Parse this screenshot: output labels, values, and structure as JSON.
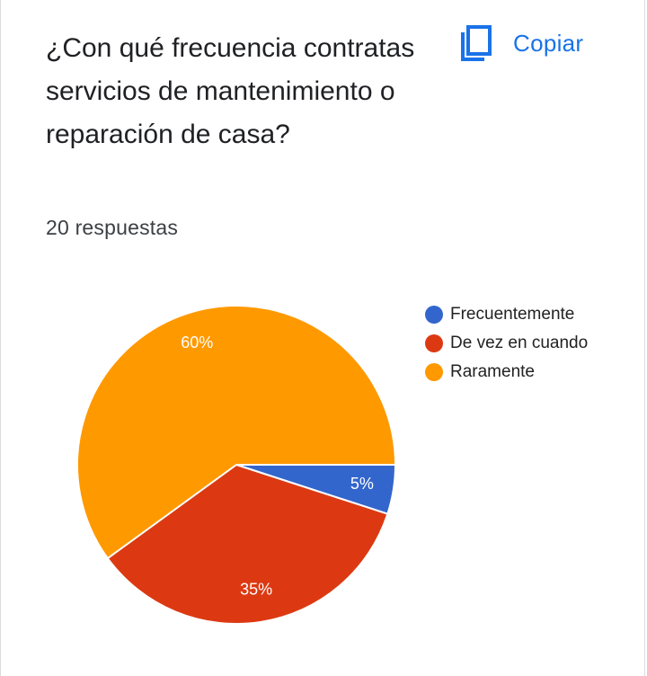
{
  "question": {
    "title": "¿Con qué frecuencia contratas servicios de mantenimiento o reparación de casa?",
    "response_count": "20 respuestas"
  },
  "copy_button": {
    "label": "Copiar",
    "icon": "copy-icon",
    "color": "#1a73e8"
  },
  "chart_data": {
    "type": "pie",
    "title": "",
    "categories": [
      "Frecuentemente",
      "De vez en cuando",
      "Raramente"
    ],
    "values": [
      5,
      35,
      60
    ],
    "data_labels": [
      "5%",
      "35%",
      "60%"
    ],
    "colors": [
      "#3366cc",
      "#dc3912",
      "#ff9900"
    ],
    "legend": {
      "position": "right",
      "entries": [
        "Frecuentemente",
        "De vez en cuando",
        "Raramente"
      ]
    }
  }
}
